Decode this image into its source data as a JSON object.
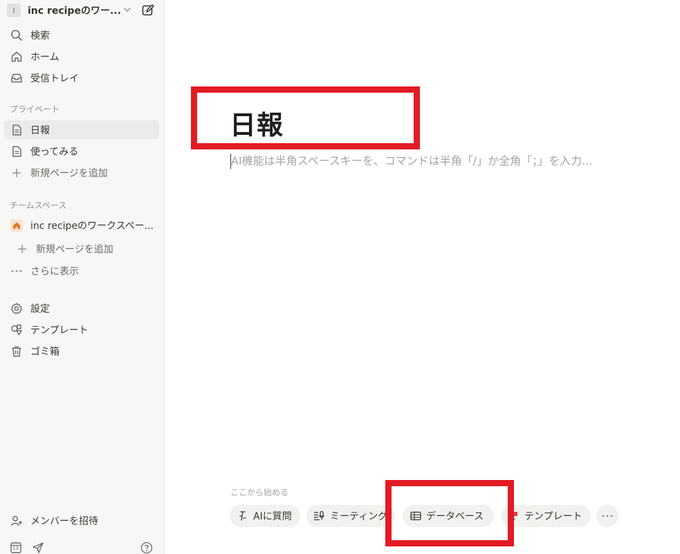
{
  "workspace": {
    "avatar_letter": "I",
    "name": "inc recipeのワー..."
  },
  "nav": {
    "search": "検索",
    "home": "ホーム",
    "inbox": "受信トレイ"
  },
  "private": {
    "label": "プライベート",
    "items": [
      {
        "label": "日報"
      },
      {
        "label": "使ってみる"
      },
      {
        "label": "新規ページを追加"
      }
    ]
  },
  "teamspace": {
    "label": "チームスペース",
    "workspace_item": "inc recipeのワークスペー...",
    "add_page": "新規ページを追加",
    "show_more": "さらに表示"
  },
  "utilities": {
    "settings": "設定",
    "templates": "テンプレート",
    "trash": "ゴミ箱"
  },
  "invite": "メンバーを招待",
  "calendar_day": "13",
  "page": {
    "title": "日報",
    "placeholder": "AI機能は半角スペースキーを、コマンドは半角「/」か全角「；」を入力..."
  },
  "start": {
    "label": "ここから始める",
    "chips": [
      {
        "label": "AIに質問"
      },
      {
        "label": "ミーティング"
      },
      {
        "label": "データベース"
      },
      {
        "label": "テンプレート"
      }
    ]
  }
}
